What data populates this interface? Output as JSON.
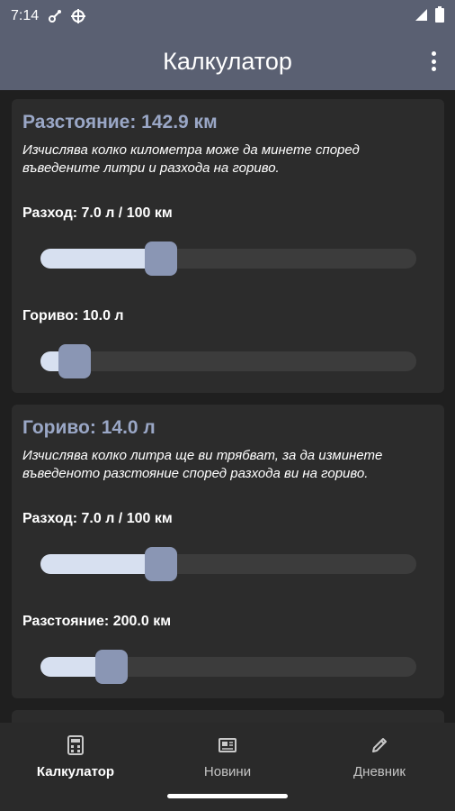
{
  "status_bar": {
    "time": "7:14"
  },
  "app_bar": {
    "title": "Калкулатор"
  },
  "cards": [
    {
      "title": "Разстояние: 142.9 км",
      "description": "Изчислява колко километра може да минете според въведените литри и разхода на гориво.",
      "sliders": [
        {
          "label": "Разход: 7.0 л / 100 км",
          "value_fraction": 0.32
        },
        {
          "label": "Гориво: 10.0 л",
          "value_fraction": 0.09
        }
      ]
    },
    {
      "title": "Гориво: 14.0 л",
      "description": "Изчислява колко литра ще ви трябват, за да изминете въведеното разстояние според разхода ви на гориво.",
      "sliders": [
        {
          "label": "Разход: 7.0 л / 100 км",
          "value_fraction": 0.32
        },
        {
          "label": "Разстояние: 200.0 км",
          "value_fraction": 0.19
        }
      ]
    }
  ],
  "bottom_nav": {
    "items": [
      {
        "label": "Калкулатор",
        "icon": "calculator-icon",
        "active": true
      },
      {
        "label": "Новини",
        "icon": "newspaper-icon",
        "active": false
      },
      {
        "label": "Дневник",
        "icon": "pencil-icon",
        "active": false
      }
    ]
  },
  "colors": {
    "app_bar": "#5a6072",
    "accent_title": "#9aa7c6",
    "slider_fill": "#d7e0f0",
    "slider_thumb": "#8a96b4",
    "card": "#2c2c2c",
    "background": "#1f1f1f"
  }
}
